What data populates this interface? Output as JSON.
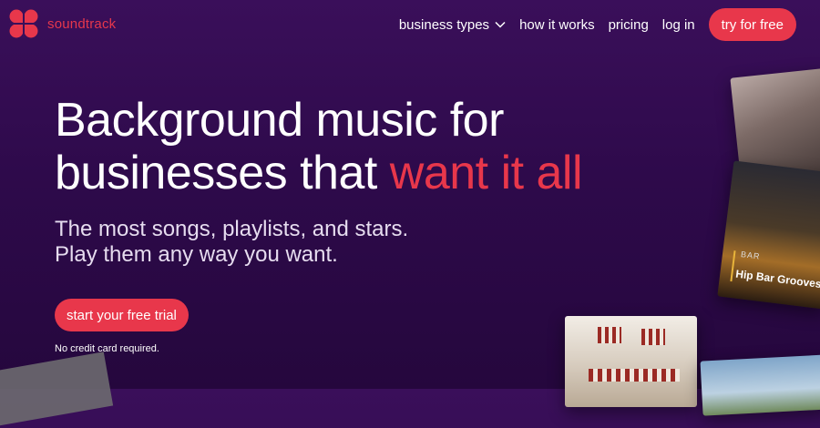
{
  "brand": {
    "name": "soundtrack",
    "logo_icon": "soundtrack-logo-icon",
    "accent_color": "#e8374b"
  },
  "nav": {
    "items": [
      {
        "label": "business types",
        "has_dropdown": true
      },
      {
        "label": "how it works"
      },
      {
        "label": "pricing"
      },
      {
        "label": "log in"
      }
    ],
    "cta_label": "try for free"
  },
  "hero": {
    "title_line1": "Background music for",
    "title_line2_plain": "businesses that ",
    "title_line2_accent": "want it all",
    "subtitle_line1": "The most songs, playlists, and stars.",
    "subtitle_line2": "Play them any way you want.",
    "cta_label": "start your free trial",
    "note": "No credit card required."
  },
  "playlist_card": {
    "category": "BAR",
    "title": "Hip Bar Grooves"
  },
  "colors": {
    "background": "#2e0a4b",
    "accent": "#e8374b"
  }
}
